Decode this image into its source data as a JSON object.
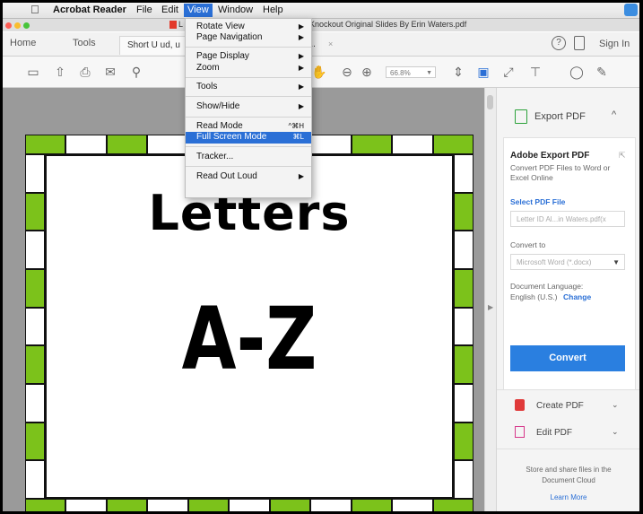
{
  "menubar": {
    "apple": "",
    "app": "Acrobat Reader",
    "items": [
      "File",
      "Edit",
      "View",
      "Window",
      "Help"
    ]
  },
  "titlebar": {
    "tab_frag": "L",
    "title": "se Knockout Original Slides By Erin Waters.pdf"
  },
  "tabs": {
    "home": "Home",
    "tools": "Tools",
    "doc_tab": "Short U ud, u",
    "doc_tab_frag": "a...",
    "help_icon": "?",
    "sign_in": "Sign In"
  },
  "toolbar": {
    "zoom": "66.8%",
    "icons": [
      "save-icon",
      "upload-icon",
      "print-icon",
      "email-icon",
      "search-icon",
      "prev-page-icon",
      "hand-icon",
      "zoom-out-icon",
      "zoom-in-icon",
      "fit-page-icon",
      "scroll-mode-icon",
      "full-screen-icon",
      "stamp-icon",
      "comment-icon",
      "sign-icon"
    ]
  },
  "slide": {
    "title": "Letters",
    "big": "A-Z"
  },
  "panel": {
    "export_label": "Export PDF",
    "card_title": "Adobe Export PDF",
    "card_desc": "Convert PDF Files to Word or Excel Online",
    "select_link": "Select PDF File",
    "file_name": "Letter ID Al...in Waters.pdf(x",
    "convert_to": "Convert to",
    "format": "Microsoft Word (*.docx)",
    "lang_label": "Document Language:",
    "lang_value": "English (U.S.)",
    "lang_change": "Change",
    "convert_btn": "Convert",
    "create_pdf": "Create PDF",
    "edit_pdf": "Edit PDF",
    "cloud_text": "Store and share files in the Document Cloud",
    "learn_more": "Learn More"
  },
  "view_menu": {
    "rotate_view": "Rotate View",
    "page_navigation": "Page Navigation",
    "page_display": "Page Display",
    "zoom": "Zoom",
    "tools": "Tools",
    "show_hide": "Show/Hide",
    "read_mode": "Read Mode",
    "read_mode_shortcut": "^⌘H",
    "full_screen": "Full Screen Mode",
    "full_screen_shortcut": "⌘L",
    "tracker": "Tracker...",
    "read_out_loud": "Read Out Loud",
    "submenu_arrow": "▶"
  },
  "colors": {
    "accent": "#2a6fd6",
    "border_green": "#7cc21b",
    "convert_blue": "#2a7fe0"
  }
}
